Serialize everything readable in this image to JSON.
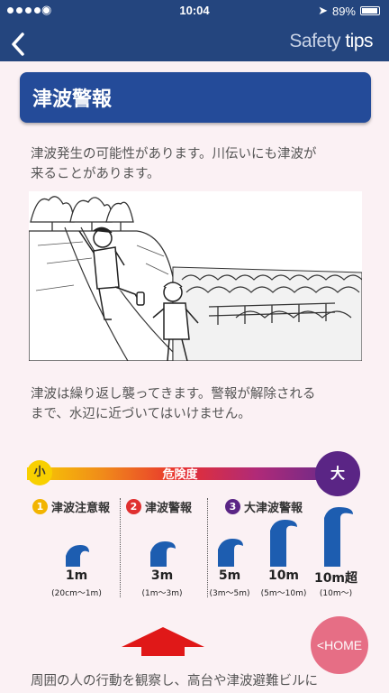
{
  "status": {
    "time": "10:04",
    "battery": "89%"
  },
  "nav": {
    "back_glyph": "<",
    "brand_light": "Safety",
    "brand_bold": "tips"
  },
  "page": {
    "title": "津波警報",
    "para1_line1": "津波発生の可能性があります。川伝いにも津波が",
    "para1_line2": "来ることがあります。",
    "para2_line1": "津波は繰り返し襲ってきます。警報が解除される",
    "para2_line2": "まで、水辺に近づいてはいけません。",
    "para3_line1": "周囲の人の行動を観察し、高台や津波避難ビルに"
  },
  "scale": {
    "low_label": "小",
    "high_label": "大",
    "bar_label": "危険度",
    "levels": [
      {
        "num": "1",
        "name": "津波注意報",
        "color": "#f2b400"
      },
      {
        "num": "2",
        "name": "津波警報",
        "color": "#e03030"
      },
      {
        "num": "3",
        "name": "大津波警報",
        "color": "#5a2585"
      }
    ],
    "waves": [
      {
        "height": "1m",
        "range": "(20cm～1m)"
      },
      {
        "height": "3m",
        "range": "(1m～3m)"
      },
      {
        "height": "5m",
        "range": "(3m～5m)"
      },
      {
        "height": "10m",
        "range": "(5m～10m)"
      },
      {
        "height": "10m超",
        "range": "(10m～)"
      }
    ]
  },
  "home": {
    "label": "HOME",
    "glyph": "<"
  },
  "colors": {
    "navbar": "#24457e",
    "title_card": "#244b99",
    "wave": "#1d5db0",
    "arrow": "#e01818",
    "home": "#e4607a"
  }
}
